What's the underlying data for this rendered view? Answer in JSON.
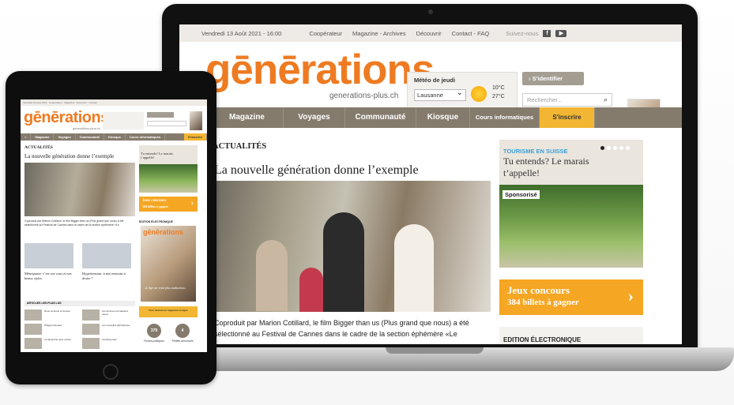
{
  "laptop": {
    "topbar": {
      "date": "Vendredi 13 Août 2021 - 16:00",
      "links": [
        "Coopérateur",
        "Magazine - Archives",
        "Découvrir",
        "Contact - FAQ"
      ],
      "follow": "Suivez-nous",
      "social_icons": [
        "facebook-icon",
        "youtube-icon"
      ]
    },
    "logo": "gēnērations",
    "logo_sub": "generations-plus.ch",
    "meteo": {
      "title": "Météo de jeudi",
      "city": "Lausanne",
      "temp_min": "10°C",
      "temp_max": "27°C"
    },
    "login_label": "S'identifier",
    "search_placeholder": "Rechercher...",
    "nav": [
      "Magazine",
      "Voyages",
      "Communauté",
      "Kiosque",
      "Cours informatiques",
      "S'inscrire"
    ],
    "section": "ACTUALITÉS",
    "headline": "La nouvelle génération donne l’exemple",
    "article_text": "Coproduit par Marion Cotillard, le film Bigger than us (Plus grand que nous) a été sélectionné au Festival de Cannes dans le cadre de la section éphémère «Le",
    "promo": {
      "tag": "TOURISME EN SUISSE",
      "title": "Tu entends? Le marais t’appelle!",
      "sponsored": "Sponsorisé"
    },
    "jeux": {
      "line1": "Jeux concours",
      "line2": "384 billets à gagner"
    },
    "edition": "EDITION ÉLECTRONIQUE"
  },
  "tablet": {
    "logo": "gēnērations",
    "logo_sub": "generations-plus.ch",
    "nav": [
      "Magazine",
      "Voyages",
      "Communauté",
      "Kiosque",
      "Cours informatiques",
      "S'inscrire"
    ],
    "section": "ACTUALITÉS",
    "headline": "La nouvelle génération donne l’exemple",
    "card1": "Ménopause: c’est sur vous et nos beaux styles",
    "card2": "Hypertension: à nos tensions à droite ?",
    "plus_lus": "ARTICLES LES PLUS LUS",
    "promo_title": "Tu entends? Le marais t’appelle!",
    "jeux1": "Jeux concours",
    "jeux2": "384 billets à gagner",
    "edition": "EDITION ÉLECTRONIQUE",
    "cover_quote": "«L’âge me rend plus audacieux»",
    "abo": "Pour abonné au magazine en ligne",
    "stat1": "379",
    "stat1_label": "Fiches pratiques",
    "stat2": "4",
    "stat2_label": "Petites annonces"
  }
}
